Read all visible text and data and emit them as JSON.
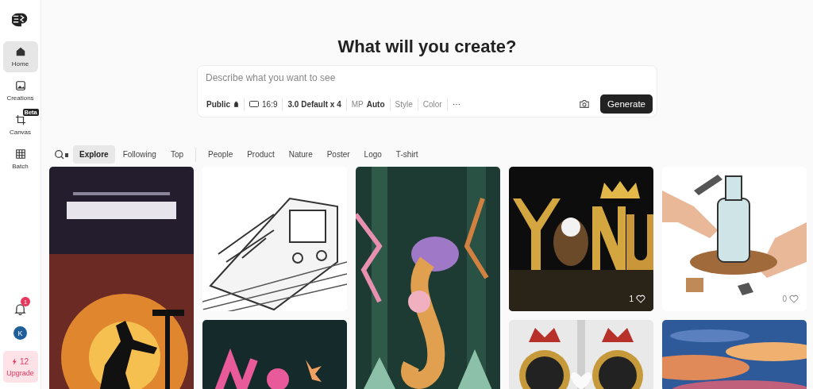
{
  "sidebar": {
    "items": [
      {
        "label": "Home",
        "selected": true
      },
      {
        "label": "Creations",
        "selected": false
      },
      {
        "label": "Canvas",
        "selected": false,
        "badge": "Beta"
      },
      {
        "label": "Batch",
        "selected": false
      }
    ],
    "notifications": {
      "count": "1"
    },
    "avatar": {
      "initial": "K"
    },
    "upgrade": {
      "credits": "12",
      "label": "Upgrade"
    }
  },
  "heading": "What will you create?",
  "prompt": {
    "placeholder": "Describe what you want to see",
    "options": [
      {
        "kind": "visibility",
        "value": "Public"
      },
      {
        "kind": "ratio",
        "value": "16:9"
      },
      {
        "kind": "model",
        "value": "3.0 Default x 4"
      },
      {
        "kind": "labeled",
        "label": "MP",
        "value": "Auto"
      },
      {
        "kind": "muted",
        "value": "Style"
      },
      {
        "kind": "muted",
        "value": "Color"
      },
      {
        "kind": "more",
        "value": "⋯"
      }
    ],
    "generate": "Generate"
  },
  "feeds": [
    {
      "label": "Explore",
      "selected": true
    },
    {
      "label": "Following",
      "selected": false
    },
    {
      "label": "Top",
      "selected": false
    }
  ],
  "categories": [
    {
      "label": "People",
      "selected": false
    },
    {
      "label": "Product",
      "selected": false
    },
    {
      "label": "Nature",
      "selected": false
    },
    {
      "label": "Poster",
      "selected": false
    },
    {
      "label": "Logo",
      "selected": false
    },
    {
      "label": "T-shirt",
      "selected": false
    }
  ],
  "gallery": {
    "columns": [
      {
        "cards": [
          {
            "kind": "picture"
          }
        ]
      },
      {
        "cards": [
          {
            "kind": "picture"
          },
          {
            "kind": "picture"
          }
        ]
      },
      {
        "cards": [
          {
            "kind": "picture"
          }
        ]
      },
      {
        "cards": [
          {
            "kind": "picture",
            "likes": "1"
          },
          {
            "kind": "picture"
          }
        ]
      },
      {
        "cards": [
          {
            "kind": "picture",
            "likes": "0"
          },
          {
            "kind": "picture"
          }
        ]
      }
    ]
  }
}
